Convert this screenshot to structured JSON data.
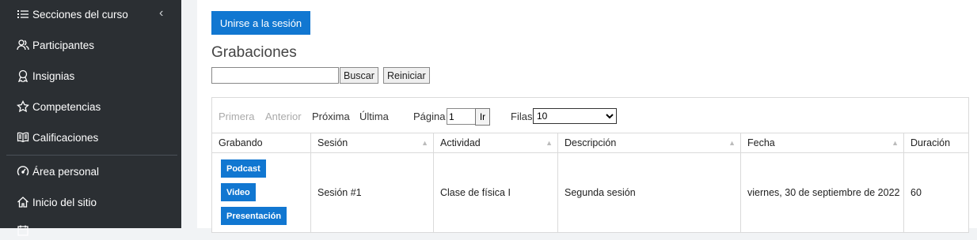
{
  "sidebar": {
    "items": [
      {
        "label": "Secciones del curso",
        "icon": "list-icon"
      },
      {
        "label": "Participantes",
        "icon": "users-icon"
      },
      {
        "label": "Insignias",
        "icon": "badge-icon"
      },
      {
        "label": "Competencias",
        "icon": "star-icon"
      },
      {
        "label": "Calificaciones",
        "icon": "book-icon"
      },
      {
        "label": "Área personal",
        "icon": "dashboard-icon"
      },
      {
        "label": "Inicio del sitio",
        "icon": "home-icon"
      }
    ],
    "collapse_glyph": "‹"
  },
  "main": {
    "join_label": "Unirse a la sesión",
    "heading": "Grabaciones",
    "search": {
      "value": "",
      "button": "Buscar",
      "reset": "Reiniciar"
    },
    "pager": {
      "first": "Primera",
      "prev": "Anterior",
      "next": "Próxima",
      "last": "Última",
      "page_label": "Página",
      "page_value": "1",
      "go": "Ir",
      "rows_label": "Filas",
      "rows_value": "10"
    },
    "table": {
      "columns": [
        "Grabando",
        "Sesión",
        "Actividad",
        "Descripción",
        "Fecha",
        "Duración"
      ],
      "rows": [
        {
          "formats": [
            "Podcast",
            "Video",
            "Presentación"
          ],
          "session": "Sesión #1",
          "activity": "Clase de física I",
          "description": "Segunda sesión",
          "date": "viernes, 30 de septiembre de 2022",
          "duration": "60"
        }
      ]
    }
  },
  "colors": {
    "sidebar_bg": "#2b2f33",
    "accent": "#1177d1"
  }
}
